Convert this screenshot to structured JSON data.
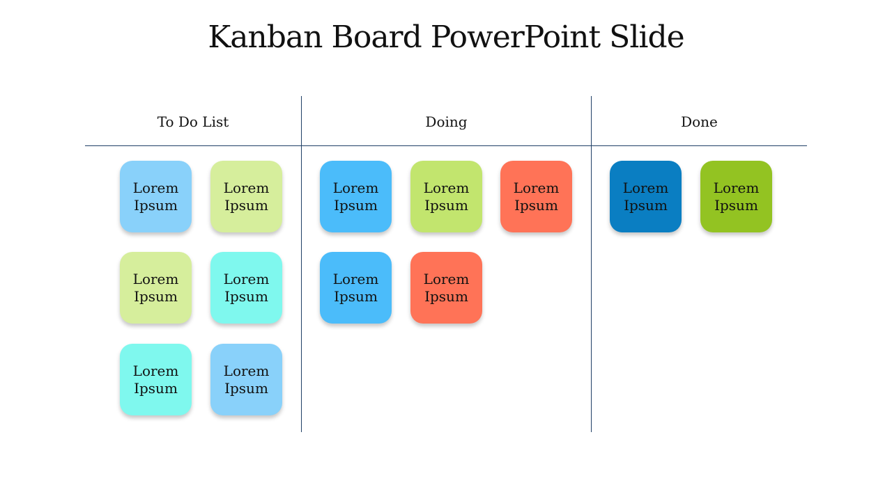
{
  "title": "Kanban Board PowerPoint Slide",
  "columns": [
    {
      "header": "To Do List",
      "cards": [
        {
          "line1": "Lorem",
          "line2": "Ipsum",
          "color": "#89d1fa"
        },
        {
          "line1": "Lorem",
          "line2": "Ipsum",
          "color": "#d6ee9c"
        },
        {
          "line1": "Lorem",
          "line2": "Ipsum",
          "color": "#d6ee9c"
        },
        {
          "line1": "Lorem",
          "line2": "Ipsum",
          "color": "#7ff8ee"
        },
        {
          "line1": "Lorem",
          "line2": "Ipsum",
          "color": "#7ff8ee"
        },
        {
          "line1": "Lorem",
          "line2": "Ipsum",
          "color": "#89d1fa"
        }
      ]
    },
    {
      "header": "Doing",
      "cards": [
        {
          "line1": "Lorem",
          "line2": "Ipsum",
          "color": "#4bbcfa"
        },
        {
          "line1": "Lorem",
          "line2": "Ipsum",
          "color": "#c2e56e"
        },
        {
          "line1": "Lorem",
          "line2": "Ipsum",
          "color": "#ff7357"
        },
        {
          "line1": "Lorem",
          "line2": "Ipsum",
          "color": "#4bbcfa"
        },
        {
          "line1": "Lorem",
          "line2": "Ipsum",
          "color": "#ff7357"
        }
      ]
    },
    {
      "header": "Done",
      "cards": [
        {
          "line1": "Lorem",
          "line2": "Ipsum",
          "color": "#0a7ec2"
        },
        {
          "line1": "Lorem",
          "line2": "Ipsum",
          "color": "#93c322"
        }
      ]
    }
  ]
}
